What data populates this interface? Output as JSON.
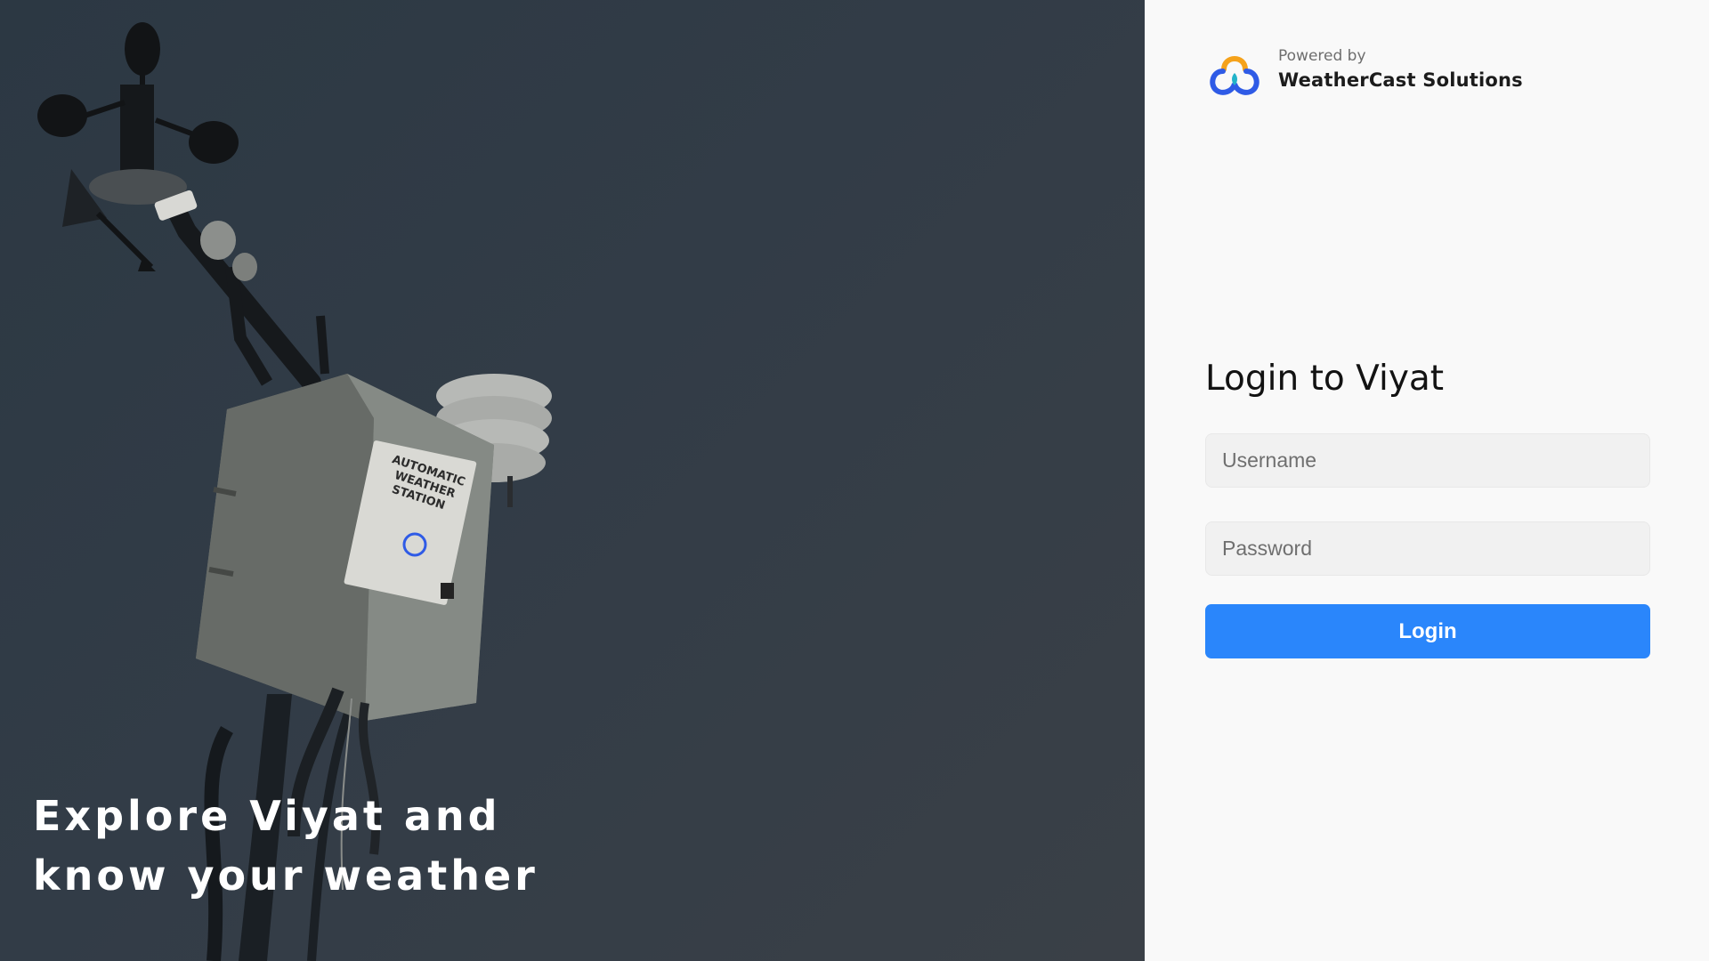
{
  "hero": {
    "tagline_line1": "Explore Viyat and",
    "tagline_line2": "know your weather",
    "image_subject": "automatic-weather-station",
    "station_label_lines": [
      "AUTOMATIC",
      "WEATHER",
      "STATION"
    ]
  },
  "brand": {
    "powered_by": "Powered by",
    "company_name": "WeatherCast Solutions",
    "logo_icon": "cloud-logo-icon"
  },
  "login": {
    "title": "Login to Viyat",
    "username_placeholder": "Username",
    "password_placeholder": "Password",
    "button_label": "Login"
  },
  "colors": {
    "hero_overlay": "#323c47",
    "panel_background": "#f9f9f9",
    "input_background": "#f1f1f1",
    "button_primary": "#2a86fb",
    "logo_orange": "#f5a21b",
    "logo_blue": "#2f5be6",
    "logo_teal": "#22b3c9"
  }
}
